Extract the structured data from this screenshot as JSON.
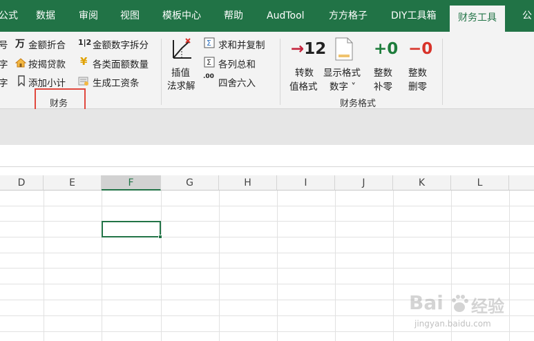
{
  "tabs": [
    {
      "label": "公式"
    },
    {
      "label": "数据"
    },
    {
      "label": "审阅"
    },
    {
      "label": "视图"
    },
    {
      "label": "模板中心"
    },
    {
      "label": "帮助"
    },
    {
      "label": "AudTool"
    },
    {
      "label": "方方格子"
    },
    {
      "label": "DIY工具箱"
    },
    {
      "label": "财务工具"
    },
    {
      "label": "公"
    }
  ],
  "ribbon": {
    "left_edge": [
      "号",
      "字",
      "字"
    ],
    "finance_items": [
      "金额折合",
      "金额数字拆分",
      "按揭贷款",
      "各类面额数量",
      "添加小计",
      "生成工资条"
    ],
    "finance_icon_glyphs": {
      "wan": "万",
      "onetwo": "1|2",
      "yen": "¥"
    },
    "interp_label_1": "插值",
    "interp_label_2": "法求解",
    "calc_items": [
      "求和并复制",
      "各列总和",
      "四舍六入"
    ],
    "round_icon_text": ".00",
    "finance_group_label": "财务",
    "format_group_label": "财务格式",
    "big_buttons": [
      {
        "number": "→12",
        "line1": "转数",
        "line2": "值格式"
      },
      {
        "number": "",
        "line1": "显示格式",
        "line2": "数字 ˅"
      },
      {
        "number": "+0",
        "line1": "整数",
        "line2": "补零"
      },
      {
        "number": "−0",
        "line1": "整数",
        "line2": "删零"
      }
    ]
  },
  "grid": {
    "columns": [
      "D",
      "E",
      "F",
      "G",
      "H",
      "I",
      "J",
      "K",
      "L"
    ],
    "selected_column": "F"
  },
  "watermark": {
    "brand": "Bai",
    "brand2": "经验",
    "url": "jingyan.baidu.com"
  },
  "colors": {
    "accent": "#217346",
    "highlight": "#e0463c"
  }
}
